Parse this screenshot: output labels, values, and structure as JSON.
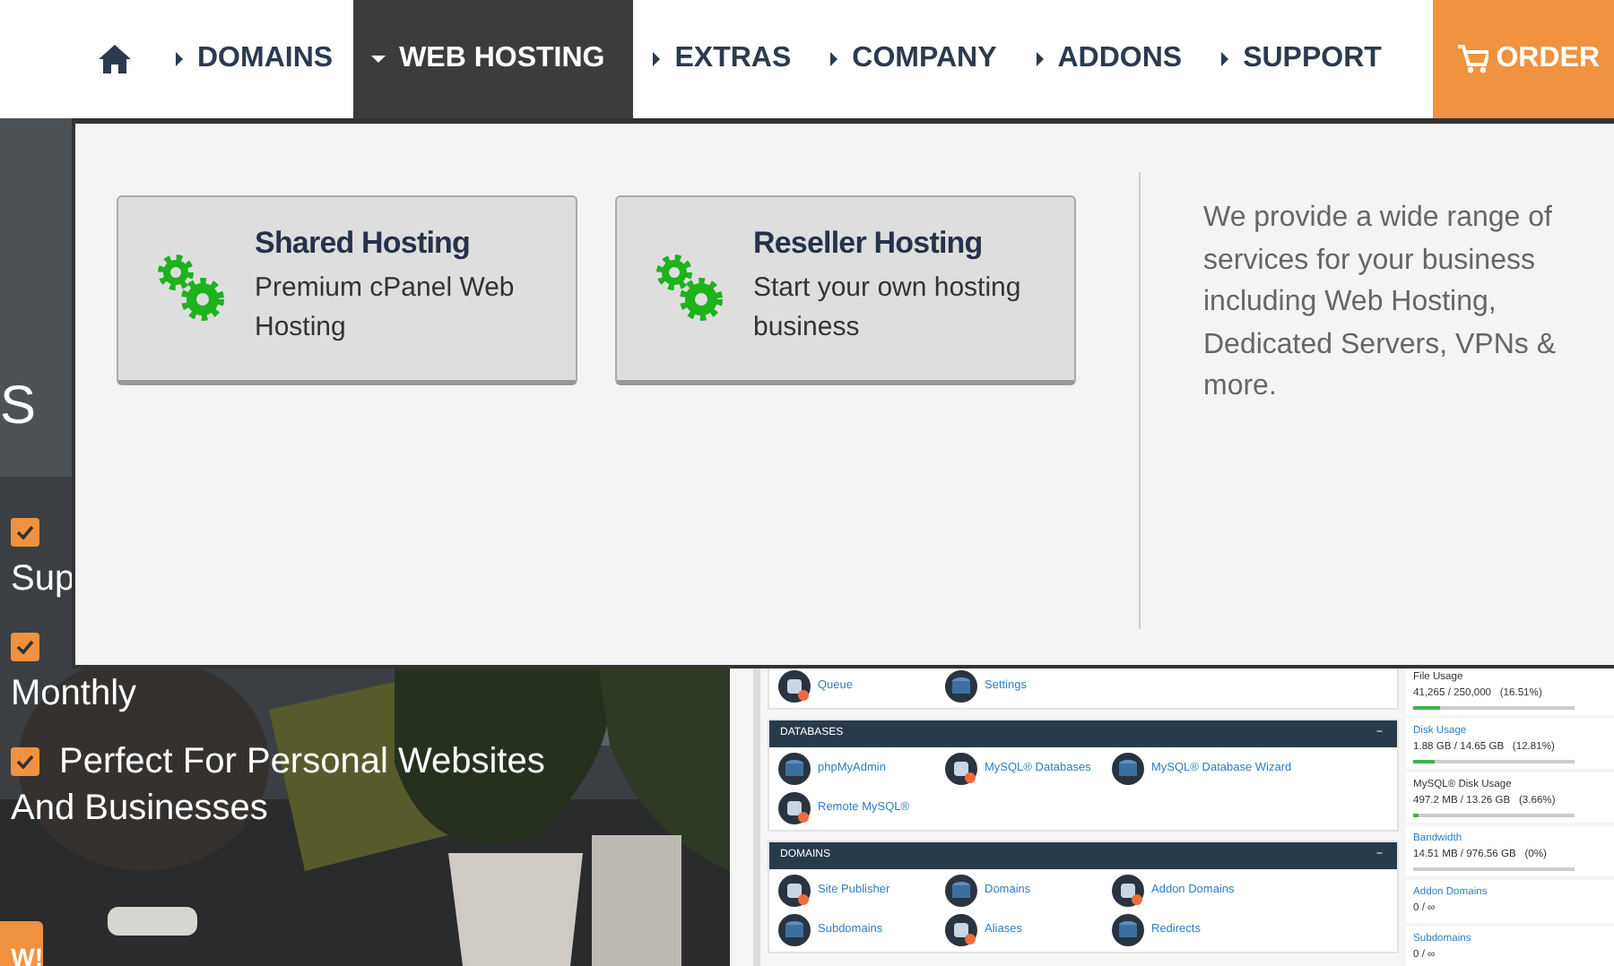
{
  "nav": {
    "menus": [
      {
        "label": "DOMAINS",
        "expanded": false
      },
      {
        "label": "WEB HOSTING",
        "expanded": true
      },
      {
        "label": "EXTRAS",
        "expanded": false
      },
      {
        "label": "COMPANY",
        "expanded": false
      },
      {
        "label": "ADDONS",
        "expanded": false
      },
      {
        "label": "SUPPORT",
        "expanded": false
      }
    ],
    "order": {
      "label": "ORDER"
    }
  },
  "dropdown": {
    "cards": [
      {
        "title": "Shared Hosting",
        "subtitle": "Premium cPanel Web Hosting"
      },
      {
        "title": "Reseller Hosting",
        "subtitle": "Start your own hosting business"
      }
    ],
    "blurb": "We provide a wide range of services for your business including Web Hosting, Dedicated Servers, VPNs & more."
  },
  "hero": {
    "heading": "S",
    "features": [
      {
        "checked": true,
        "lines": [
          "Sup"
        ]
      },
      {
        "checked": true,
        "lines": [
          "Monthly"
        ]
      },
      {
        "checked": true,
        "lead": "Perfect For Personal Websites",
        "lines": [
          "And Businesses"
        ]
      }
    ],
    "button": "W!"
  },
  "cpanel": {
    "sections": [
      {
        "items": [
          "Queue",
          "Settings"
        ]
      },
      {
        "title": "DATABASES",
        "toggle": "−",
        "items": [
          "phpMyAdmin",
          "MySQL® Databases",
          "MySQL® Database Wizard",
          "Remote MySQL®"
        ]
      },
      {
        "title": "DOMAINS",
        "toggle": "−",
        "items": [
          "Site Publisher",
          "Domains",
          "Addon Domains",
          "Subdomains",
          "Aliases",
          "Redirects"
        ]
      }
    ],
    "stats": [
      {
        "label": "File Usage",
        "link": false,
        "value": "41,265 / 250,000   (16.51%)",
        "level": 0.165
      },
      {
        "label": "Disk Usage",
        "link": true,
        "value": "1.88 GB / 14.65 GB   (12.81%)",
        "level": 0.128
      },
      {
        "label": "MySQL® Disk Usage",
        "link": false,
        "value": "497.2 MB / 13.26 GB   (3.66%)",
        "level": 0.037
      },
      {
        "label": "Bandwidth",
        "link": true,
        "value": "14.51 MB / 976.56 GB   (0%)",
        "level": 0
      },
      {
        "label": "Addon Domains",
        "link": true,
        "value": "0 / ∞"
      },
      {
        "label": "Subdomains",
        "link": true,
        "value": "0 / ∞"
      }
    ]
  }
}
